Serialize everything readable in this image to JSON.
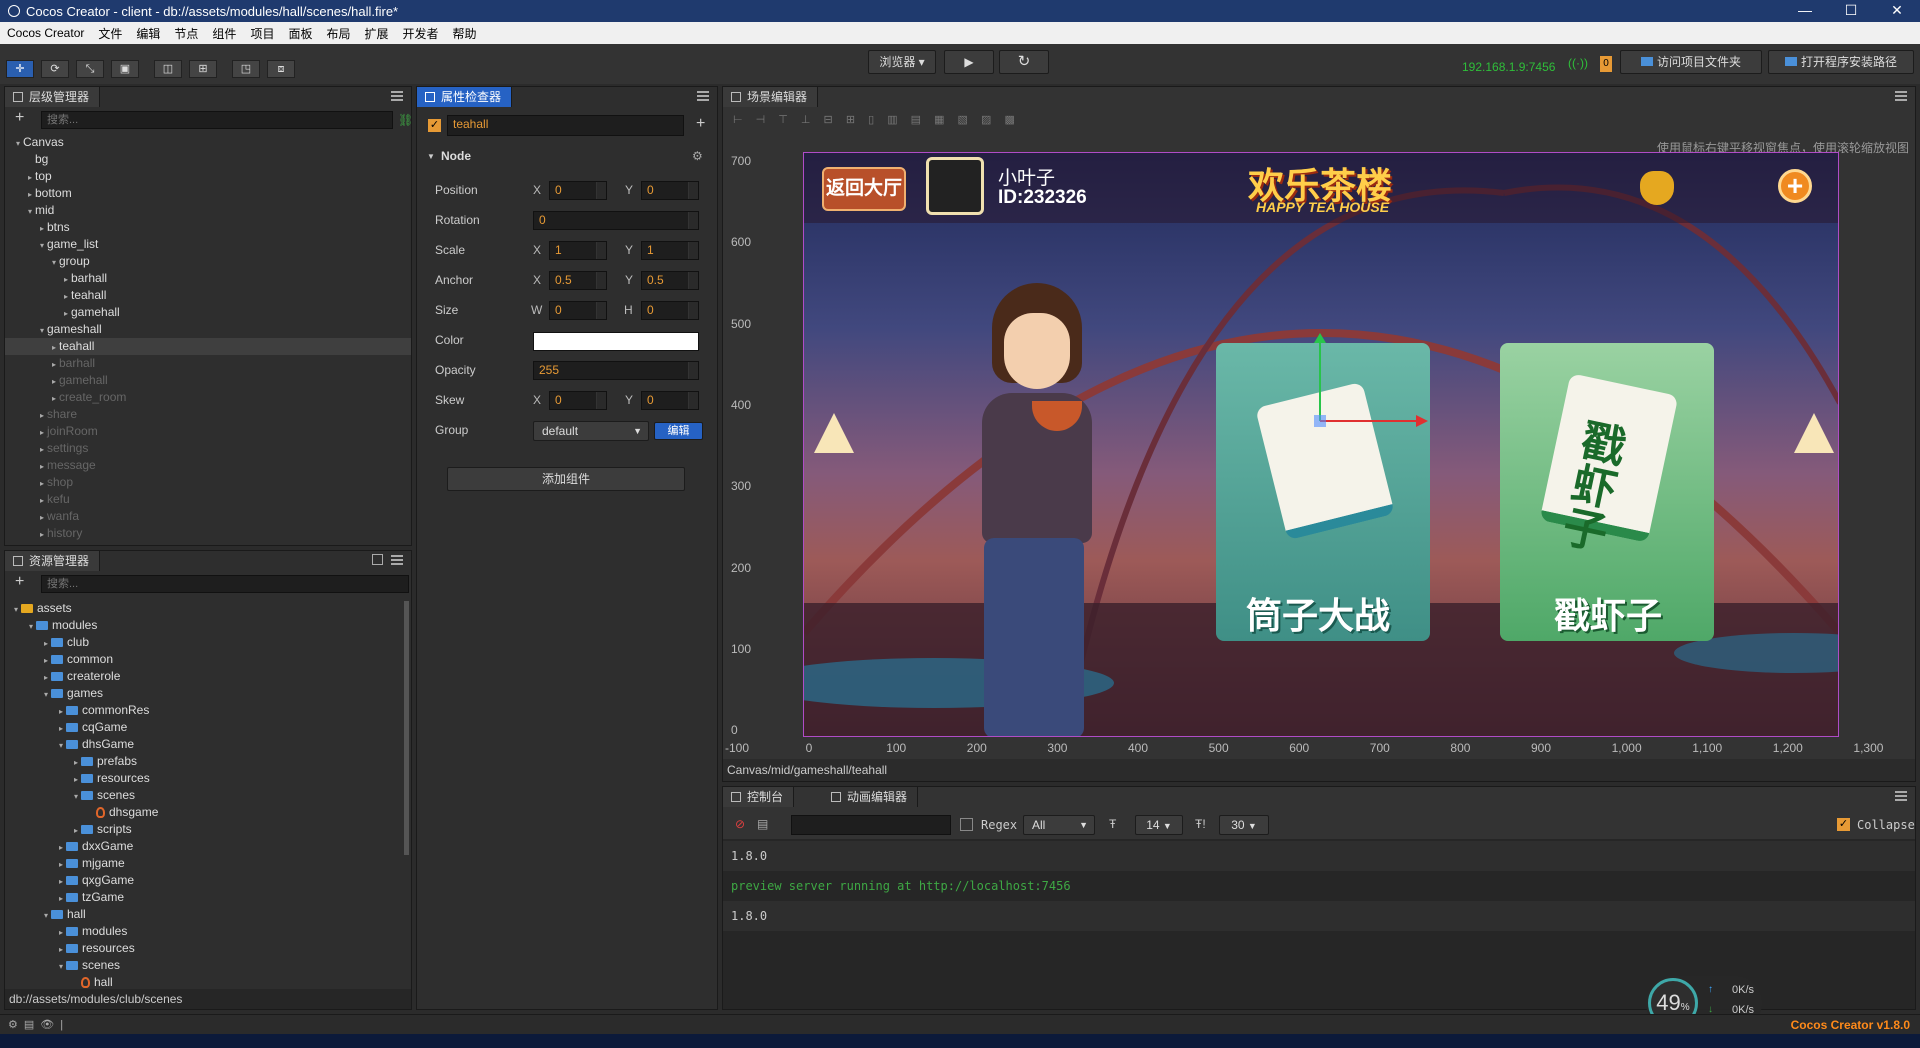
{
  "window": {
    "title": "Cocos Creator - client - db://assets/modules/hall/scenes/hall.fire*",
    "minimize": "—",
    "maximize": "☐",
    "close": "✕"
  },
  "menu": [
    "Cocos Creator",
    "文件",
    "编辑",
    "节点",
    "组件",
    "项目",
    "面板",
    "布局",
    "扩展",
    "开发者",
    "帮助"
  ],
  "toolbar": {
    "browser_select": "浏览器 ▾",
    "play": "▶",
    "refresh": "↻",
    "ip": "192.168.1.9:7456",
    "wifi": "((·))",
    "badge": "0",
    "open_project": "访问项目文件夹",
    "open_install": "打开程序安装路径"
  },
  "hierarchy": {
    "title": "层级管理器",
    "search_placeholder": "搜索...",
    "items": [
      {
        "label": "Canvas",
        "indent": 0,
        "arrow": "▾",
        "state": "normal"
      },
      {
        "label": "bg",
        "indent": 1,
        "arrow": "",
        "state": "normal"
      },
      {
        "label": "top",
        "indent": 1,
        "arrow": "▸",
        "state": "normal"
      },
      {
        "label": "bottom",
        "indent": 1,
        "arrow": "▸",
        "state": "normal"
      },
      {
        "label": "mid",
        "indent": 1,
        "arrow": "▾",
        "state": "normal"
      },
      {
        "label": "btns",
        "indent": 2,
        "arrow": "▸",
        "state": "normal"
      },
      {
        "label": "game_list",
        "indent": 2,
        "arrow": "▾",
        "state": "normal"
      },
      {
        "label": "group",
        "indent": 3,
        "arrow": "▾",
        "state": "normal"
      },
      {
        "label": "barhall",
        "indent": 4,
        "arrow": "▸",
        "state": "normal"
      },
      {
        "label": "teahall",
        "indent": 4,
        "arrow": "▸",
        "state": "normal"
      },
      {
        "label": "gamehall",
        "indent": 4,
        "arrow": "▸",
        "state": "normal"
      },
      {
        "label": "gameshall",
        "indent": 2,
        "arrow": "▾",
        "state": "normal"
      },
      {
        "label": "teahall",
        "indent": 3,
        "arrow": "▸",
        "state": "selected"
      },
      {
        "label": "barhall",
        "indent": 3,
        "arrow": "▸",
        "state": "dim"
      },
      {
        "label": "gamehall",
        "indent": 3,
        "arrow": "▸",
        "state": "dim"
      },
      {
        "label": "create_room",
        "indent": 3,
        "arrow": "▸",
        "state": "dim"
      },
      {
        "label": "share",
        "indent": 2,
        "arrow": "▸",
        "state": "dim"
      },
      {
        "label": "joinRoom",
        "indent": 2,
        "arrow": "▸",
        "state": "dim"
      },
      {
        "label": "settings",
        "indent": 2,
        "arrow": "▸",
        "state": "dim"
      },
      {
        "label": "message",
        "indent": 2,
        "arrow": "▸",
        "state": "dim"
      },
      {
        "label": "shop",
        "indent": 2,
        "arrow": "▸",
        "state": "dim"
      },
      {
        "label": "kefu",
        "indent": 2,
        "arrow": "▸",
        "state": "dim"
      },
      {
        "label": "wanfa",
        "indent": 2,
        "arrow": "▸",
        "state": "dim"
      },
      {
        "label": "history",
        "indent": 2,
        "arrow": "▸",
        "state": "dim"
      }
    ]
  },
  "assets": {
    "title": "资源管理器",
    "search_placeholder": "搜索...",
    "status_path": "db://assets/modules/club/scenes",
    "items": [
      {
        "label": "assets",
        "indent": 0,
        "arrow": "▾",
        "kind": "root"
      },
      {
        "label": "modules",
        "indent": 1,
        "arrow": "▾",
        "kind": "folder"
      },
      {
        "label": "club",
        "indent": 2,
        "arrow": "▸",
        "kind": "folder"
      },
      {
        "label": "common",
        "indent": 2,
        "arrow": "▸",
        "kind": "folder"
      },
      {
        "label": "createrole",
        "indent": 2,
        "arrow": "▸",
        "kind": "folder"
      },
      {
        "label": "games",
        "indent": 2,
        "arrow": "▾",
        "kind": "folder"
      },
      {
        "label": "commonRes",
        "indent": 3,
        "arrow": "▸",
        "kind": "folder"
      },
      {
        "label": "cqGame",
        "indent": 3,
        "arrow": "▸",
        "kind": "folder"
      },
      {
        "label": "dhsGame",
        "indent": 3,
        "arrow": "▾",
        "kind": "folder"
      },
      {
        "label": "prefabs",
        "indent": 4,
        "arrow": "▸",
        "kind": "folder"
      },
      {
        "label": "resources",
        "indent": 4,
        "arrow": "▸",
        "kind": "folder"
      },
      {
        "label": "scenes",
        "indent": 4,
        "arrow": "▾",
        "kind": "folder"
      },
      {
        "label": "dhsgame",
        "indent": 5,
        "arrow": "",
        "kind": "fire"
      },
      {
        "label": "scripts",
        "indent": 4,
        "arrow": "▸",
        "kind": "folder"
      },
      {
        "label": "dxxGame",
        "indent": 3,
        "arrow": "▸",
        "kind": "folder"
      },
      {
        "label": "mjgame",
        "indent": 3,
        "arrow": "▸",
        "kind": "folder"
      },
      {
        "label": "qxgGame",
        "indent": 3,
        "arrow": "▸",
        "kind": "folder"
      },
      {
        "label": "tzGame",
        "indent": 3,
        "arrow": "▸",
        "kind": "folder"
      },
      {
        "label": "hall",
        "indent": 2,
        "arrow": "▾",
        "kind": "folder"
      },
      {
        "label": "modules",
        "indent": 3,
        "arrow": "▸",
        "kind": "folder"
      },
      {
        "label": "resources",
        "indent": 3,
        "arrow": "▸",
        "kind": "folder"
      },
      {
        "label": "scenes",
        "indent": 3,
        "arrow": "▾",
        "kind": "folder"
      },
      {
        "label": "hall",
        "indent": 4,
        "arrow": "",
        "kind": "fire"
      }
    ]
  },
  "inspector": {
    "title": "属性检查器",
    "node_name": "teahall",
    "section": "Node",
    "position": {
      "label": "Position",
      "x": "0",
      "y": "0"
    },
    "rotation": {
      "label": "Rotation",
      "value": "0"
    },
    "scale": {
      "label": "Scale",
      "x": "1",
      "y": "1"
    },
    "anchor": {
      "label": "Anchor",
      "x": "0.5",
      "y": "0.5"
    },
    "size": {
      "label": "Size",
      "w": "0",
      "h": "0"
    },
    "color": {
      "label": "Color",
      "value": "#ffffff"
    },
    "opacity": {
      "label": "Opacity",
      "value": "255"
    },
    "skew": {
      "label": "Skew",
      "x": "0",
      "y": "0"
    },
    "group": {
      "label": "Group",
      "value": "default",
      "edit": "编辑"
    },
    "add_component": "添加组件",
    "axis": {
      "x": "X",
      "y": "Y",
      "w": "W",
      "h": "H"
    }
  },
  "scene": {
    "title": "场景编辑器",
    "hint": "使用鼠标右键平移视窗焦点，使用滚轮缩放视图",
    "y_ticks": [
      "700",
      "600",
      "500",
      "400",
      "300",
      "200",
      "100",
      "0"
    ],
    "x_ticks": [
      "-100",
      "0",
      "100",
      "200",
      "300",
      "400",
      "500",
      "600",
      "700",
      "800",
      "900",
      "1,000",
      "1,100",
      "1,200",
      "1,300"
    ],
    "path": "Canvas/mid/gameshall/teahall",
    "game": {
      "back": "返回大厅",
      "player_name": "小叶子",
      "player_id": "ID:232326",
      "brand_cn": "欢乐茶楼",
      "brand_en": "HAPPY TEA HOUSE",
      "plus": "+",
      "card1": "筒子大战",
      "card2": "戳虾子",
      "card2_tile": "戳虾子"
    }
  },
  "console": {
    "tab_console": "控制台",
    "tab_anim": "动画编辑器",
    "regex_label": "Regex",
    "filter": "All",
    "font_size": "14",
    "line_count": "30",
    "collapse": "Collapse",
    "logs": [
      {
        "text": "1.8.0",
        "color": "#cccccc"
      },
      {
        "text": "preview server running at http://localhost:7456",
        "color": "#3ea844"
      },
      {
        "text": "1.8.0",
        "color": "#cccccc"
      }
    ]
  },
  "stats": {
    "percent": "49",
    "unit": "%",
    "up": "0K/s",
    "down": "0K/s"
  },
  "statusbar": {
    "version": "Cocos Creator v1.8.0"
  },
  "colors": {
    "accent": "#2662c4",
    "ip": "#2fbf3a",
    "version": "#ff8a1a",
    "selection_outline": "#b04cc7"
  }
}
